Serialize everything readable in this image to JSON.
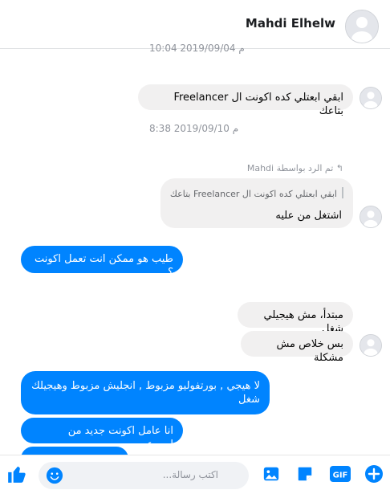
{
  "header": {
    "contact_name": "Mahdi Elhelw"
  },
  "conversation": {
    "timestamp_top": "10:04 2019/09/04 م",
    "message_1": "ابقي ابعتلي كده اكونت ال Freelancer  بتاعك",
    "timestamp_2": "8:38 2019/09/10 م",
    "reply_note": "تم الرد بواسطة Mahdi",
    "quoted_text": "ابقي ابعتلي كده اكونت ال Freelancer بتاعك",
    "reply_text": "اشتغل من عليه",
    "outgoing_1": "طيب هو ممكن انت تعمل اكونت ؟",
    "incoming_2": "مبتدأ، مش هيجيلي شغل",
    "incoming_3": "بس خلاص مش مشكلة",
    "outgoing_2": "لا هيجي , بورتفوليو مزبوط , انجليش مزبوط وهيجيلك شغل",
    "outgoing_3": "انا عامل اكونت جديد من اسبوعين"
  },
  "composer": {
    "placeholder": "اكتب رسالة..."
  },
  "colors": {
    "accent": "#0084ff",
    "incoming_bubble": "#f1f0f0"
  },
  "icons": [
    "like-icon",
    "emoji-icon",
    "image-icon",
    "sticker-icon",
    "gif-icon",
    "plus-icon"
  ]
}
